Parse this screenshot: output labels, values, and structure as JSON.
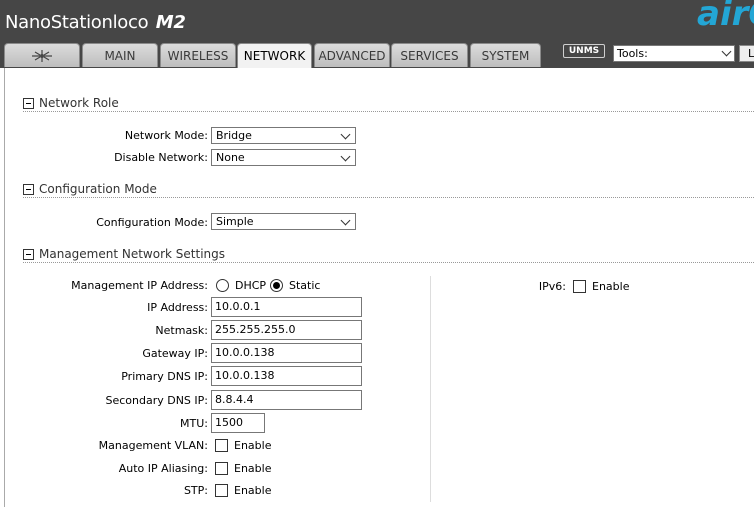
{
  "header": {
    "brand_prefix": "NanoStation",
    "brand_loco": "loco",
    "brand_model": "M2",
    "logo_text": "air",
    "logo_letter": "O"
  },
  "tabs": [
    {
      "label": "",
      "icon": "ubiquiti-logo-icon"
    },
    {
      "label": "MAIN"
    },
    {
      "label": "WIRELESS"
    },
    {
      "label": "NETWORK",
      "active": true
    },
    {
      "label": "ADVANCED"
    },
    {
      "label": "SERVICES"
    },
    {
      "label": "SYSTEM"
    }
  ],
  "toolbar": {
    "unms_label": "UNMS",
    "tools_value": "Tools:",
    "logout_stub": "L"
  },
  "network_role": {
    "title": "Network Role",
    "network_mode_label": "Network Mode:",
    "network_mode_value": "Bridge",
    "disable_network_label": "Disable Network:",
    "disable_network_value": "None"
  },
  "configuration_mode": {
    "title": "Configuration Mode",
    "label": "Configuration Mode:",
    "value": "Simple"
  },
  "management": {
    "title": "Management Network Settings",
    "ip_mode_label": "Management IP Address:",
    "dhcp_label": "DHCP",
    "static_label": "Static",
    "ip_label": "IP Address:",
    "ip_value": "10.0.0.1",
    "netmask_label": "Netmask:",
    "netmask_value": "255.255.255.0",
    "gateway_label": "Gateway IP:",
    "gateway_value": "10.0.0.138",
    "primary_dns_label": "Primary DNS IP:",
    "primary_dns_value": "10.0.0.138",
    "secondary_dns_label": "Secondary DNS IP:",
    "secondary_dns_value": "8.8.4.4",
    "mtu_label": "MTU:",
    "mtu_value": "1500",
    "vlan_label": "Management VLAN:",
    "aliasing_label": "Auto IP Aliasing:",
    "stp_label": "STP:",
    "enable_label": "Enable",
    "ipv6_label": "IPv6:"
  }
}
